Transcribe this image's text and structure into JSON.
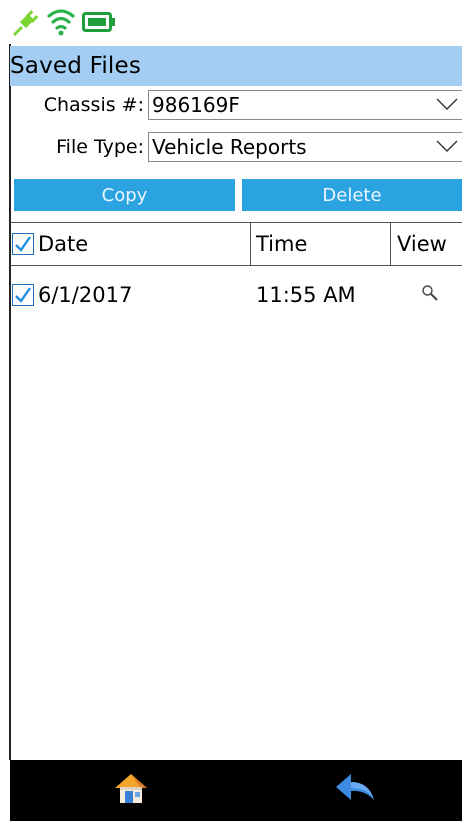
{
  "status_bar": {
    "icons": [
      "plug-icon",
      "wifi-icon",
      "battery-icon"
    ],
    "colors": {
      "plug": "#7bd432",
      "wifi": "#2bb24c",
      "battery": "#1f9e3a"
    }
  },
  "header": {
    "title": "Saved Files",
    "background": "#a3cdf2"
  },
  "form": {
    "chassis": {
      "label": "Chassis #:",
      "value": "986169F"
    },
    "file_type": {
      "label": "File Type:",
      "value": "Vehicle Reports"
    }
  },
  "actions": {
    "copy_label": "Copy",
    "delete_label": "Delete",
    "button_color": "#2aa3e0"
  },
  "table": {
    "columns": [
      "Date",
      "Time",
      "View"
    ],
    "header_checkbox_checked": true,
    "rows": [
      {
        "checked": true,
        "date": "6/1/2017",
        "time": "11:55 AM",
        "view_icon": "magnifier-icon"
      }
    ]
  },
  "bottom_nav": {
    "items": [
      "home-icon",
      "back-arrow-icon"
    ]
  }
}
